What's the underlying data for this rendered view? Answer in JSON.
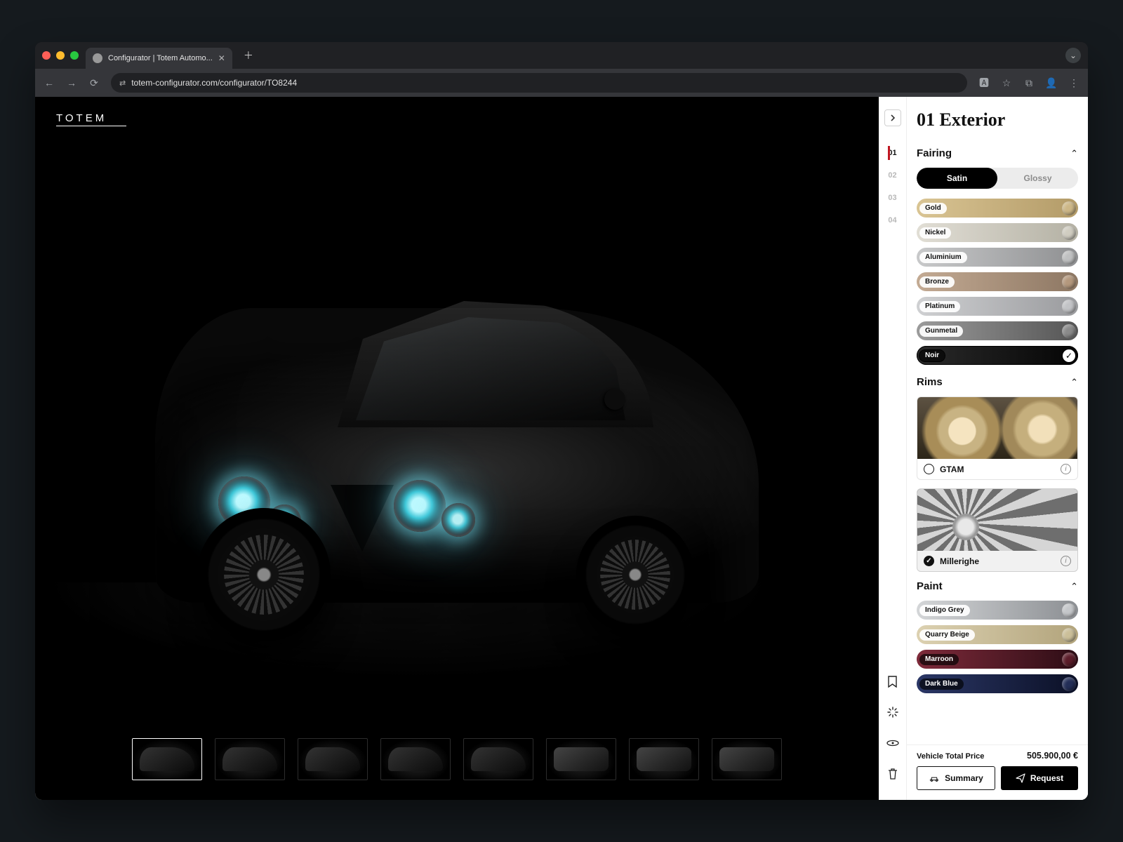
{
  "browser": {
    "tab_title": "Configurator | Totem Automo...",
    "url": "totem-configurator.com/configurator/TO8244"
  },
  "brand": "TOTEM",
  "steps": [
    {
      "num": "01",
      "active": true
    },
    {
      "num": "02",
      "active": false
    },
    {
      "num": "03",
      "active": false
    },
    {
      "num": "04",
      "active": false
    }
  ],
  "panel_title": "01 Exterior",
  "sections": {
    "fairing": {
      "title": "Fairing",
      "finish_options": [
        "Satin",
        "Glossy"
      ],
      "finish_selected": "Satin",
      "colors": [
        {
          "name": "Gold",
          "g1": "#d9c493",
          "g2": "#b39b68",
          "dot": "#cdb787"
        },
        {
          "name": "Nickel",
          "g1": "#e1ded5",
          "g2": "#b4b1a4",
          "dot": "#d0cdc1"
        },
        {
          "name": "Aluminium",
          "g1": "#c8c9ca",
          "g2": "#8f9092",
          "dot": "#bfc0c1"
        },
        {
          "name": "Bronze",
          "g1": "#c3aa93",
          "g2": "#8d7763",
          "dot": "#b4987d"
        },
        {
          "name": "Platinum",
          "g1": "#cfd0d2",
          "g2": "#9a9b9e",
          "dot": "#c2c3c6"
        },
        {
          "name": "Gunmetal",
          "g1": "#9b9b9b",
          "g2": "#555555",
          "dot": "#8a8a8a"
        },
        {
          "name": "Noir",
          "g1": "#2a2a2a",
          "g2": "#050505",
          "dot": "#111111",
          "selected": true,
          "dark": true
        }
      ]
    },
    "rims": {
      "title": "Rims",
      "options": [
        {
          "name": "GTAM",
          "selected": false,
          "art": "gtam"
        },
        {
          "name": "Millerighe",
          "selected": true,
          "art": "mille"
        }
      ]
    },
    "paint": {
      "title": "Paint",
      "colors": [
        {
          "name": "Indigo Grey",
          "g1": "#d4d6d8",
          "g2": "#8c8f93",
          "dot": "#c5c7ca"
        },
        {
          "name": "Quarry Beige",
          "g1": "#dcd1b1",
          "g2": "#b2a47c",
          "dot": "#cbbf99"
        },
        {
          "name": "Marroon",
          "g1": "#7e2a3a",
          "g2": "#2d0d15",
          "dot": "#5c1d2a",
          "dark": true
        },
        {
          "name": "Dark Blue",
          "g1": "#2b3766",
          "g2": "#0b1026",
          "dot": "#232e57",
          "dark": true
        }
      ]
    }
  },
  "thumbnails": [
    {
      "kind": "ext",
      "active": true
    },
    {
      "kind": "ext"
    },
    {
      "kind": "ext"
    },
    {
      "kind": "ext"
    },
    {
      "kind": "ext"
    },
    {
      "kind": "int"
    },
    {
      "kind": "int"
    },
    {
      "kind": "int"
    }
  ],
  "footer": {
    "price_label": "Vehicle Total Price",
    "price_value": "505.900,00 €",
    "summary_btn": "Summary",
    "request_btn": "Request"
  },
  "rail_icons": [
    "bookmark",
    "loader",
    "view-360",
    "trash"
  ]
}
